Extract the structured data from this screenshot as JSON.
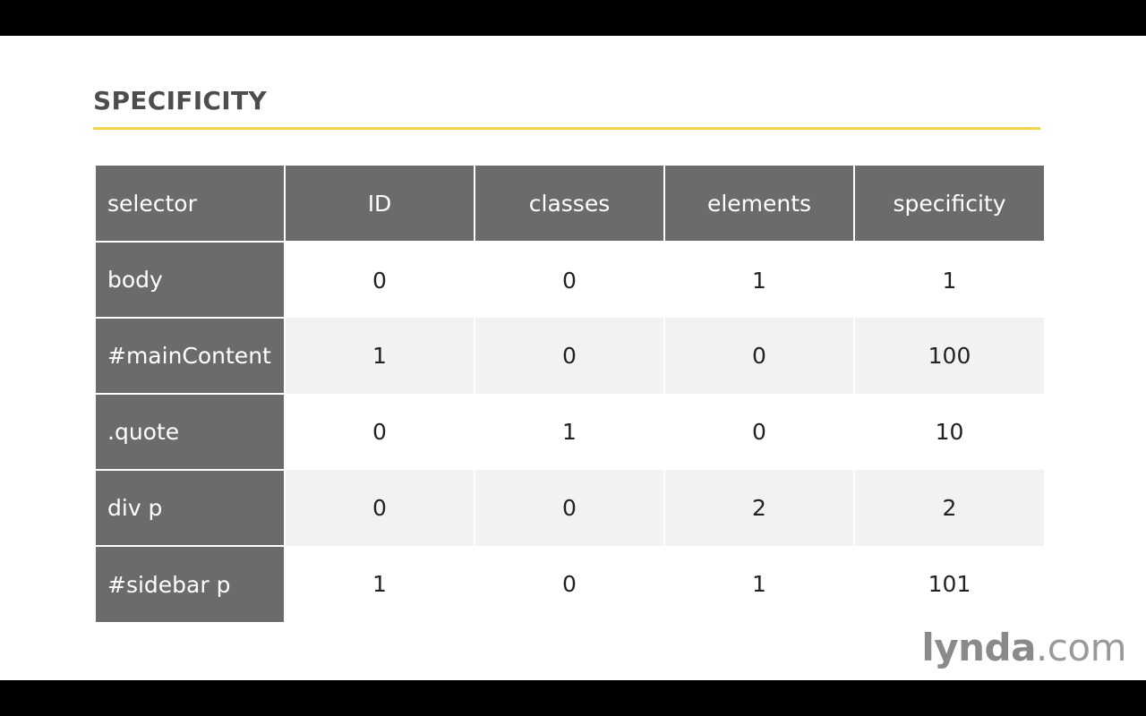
{
  "slide": {
    "title": "SPECIFICITY"
  },
  "table": {
    "headers": [
      "selector",
      "ID",
      "classes",
      "elements",
      "specificity"
    ],
    "rows": [
      {
        "selector": "body",
        "id": "0",
        "classes": "0",
        "elements": "1",
        "specificity": "1"
      },
      {
        "selector": "#mainContent",
        "id": "1",
        "classes": "0",
        "elements": "0",
        "specificity": "100"
      },
      {
        "selector": ".quote",
        "id": "0",
        "classes": "1",
        "elements": "0",
        "specificity": "10"
      },
      {
        "selector": "div p",
        "id": "0",
        "classes": "0",
        "elements": "2",
        "specificity": "2"
      },
      {
        "selector": "#sidebar p",
        "id": "1",
        "classes": "0",
        "elements": "1",
        "specificity": "101"
      }
    ]
  },
  "logo": {
    "brand": "lynda",
    "tld": ".com"
  },
  "colors": {
    "accent_rule": "#f2d44a",
    "header_bg": "#6b6b6b",
    "stripe_bg": "#f1f2f1"
  }
}
